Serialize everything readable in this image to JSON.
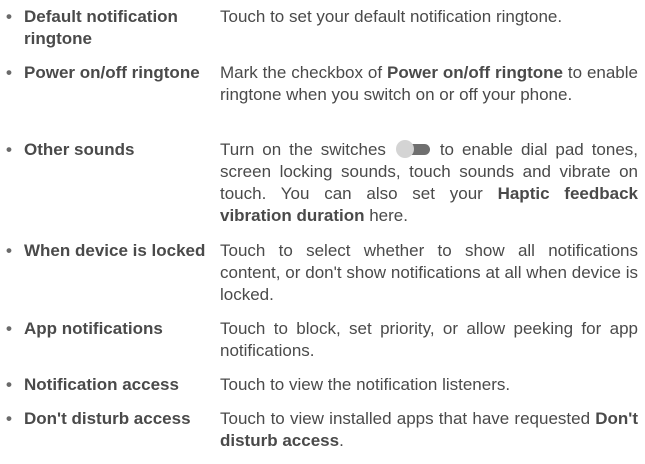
{
  "items": [
    {
      "bullet": "•",
      "term": "Default notification ringtone",
      "desc": [
        {
          "t": "Touch to set your default notification ringtone.",
          "b": false
        }
      ]
    },
    {
      "bullet": "•",
      "term": "Power on/off ringtone",
      "desc": [
        {
          "t": "Mark the checkbox of ",
          "b": false
        },
        {
          "t": "Power on/off ringtone",
          "b": true
        },
        {
          "t": " to enable ringtone when you switch on or off your phone.",
          "b": false
        }
      ]
    },
    {
      "bullet": "•",
      "term": "Other sounds",
      "desc": [
        {
          "t": "Turn on the switches ",
          "b": false
        },
        {
          "toggle": "toggle-switch-icon"
        },
        {
          "t": " to enable dial pad tones, screen locking sounds, touch sounds and vibrate on touch. You can also set your ",
          "b": false
        },
        {
          "t": "Haptic feedback vibration duration",
          "b": true
        },
        {
          "t": " here.",
          "b": false
        }
      ]
    },
    {
      "bullet": "•",
      "term": "When device is locked",
      "desc": [
        {
          "t": "Touch to select whether to show all notifications content, or don't show notifications at all when device is locked.",
          "b": false
        }
      ]
    },
    {
      "bullet": "•",
      "term": "App notifications",
      "desc": [
        {
          "t": "Touch to block, set priority, or allow peeking for app notifications.",
          "b": false
        }
      ]
    },
    {
      "bullet": "•",
      "term": "Notification access",
      "desc": [
        {
          "t": "Touch to view the notification listeners.",
          "b": false
        }
      ]
    },
    {
      "bullet": "•",
      "term": "Don't disturb access",
      "desc": [
        {
          "t": "Touch to view installed apps that have requested ",
          "b": false
        },
        {
          "t": "Don't disturb access",
          "b": true
        },
        {
          "t": ".",
          "b": false
        }
      ]
    }
  ],
  "colors": {
    "text": "#4a4a4a",
    "toggle_track": "#6f6f6f",
    "toggle_knob": "#d4d4d4"
  }
}
